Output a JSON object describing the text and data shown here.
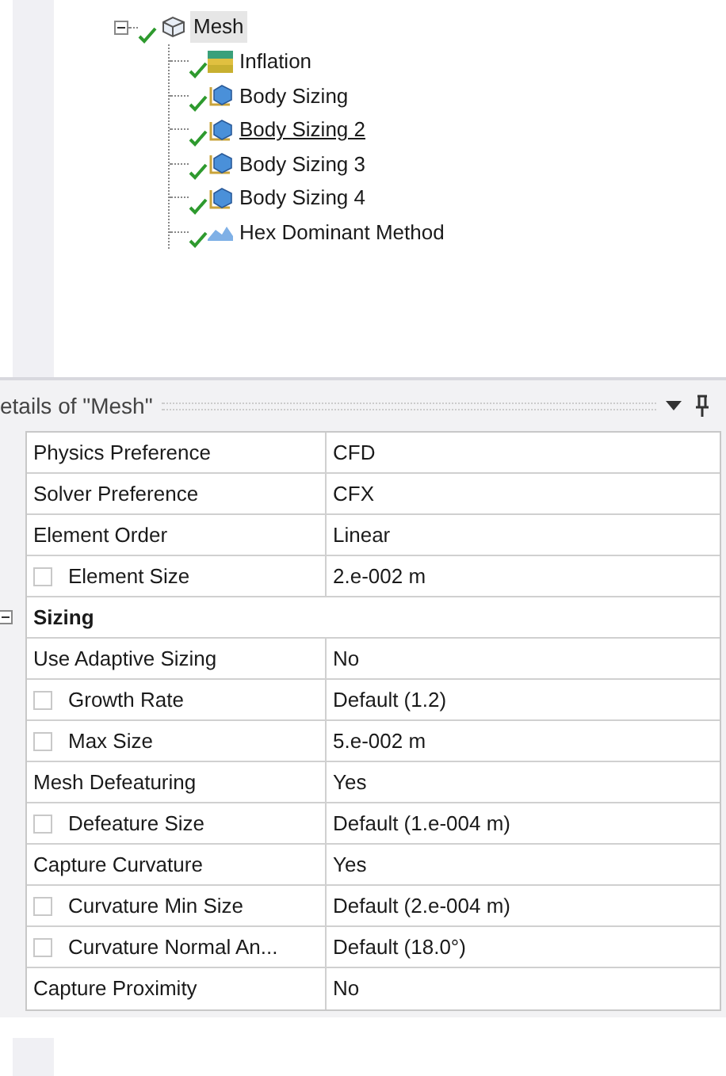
{
  "tree": {
    "label": "Mesh",
    "selected": true,
    "expanded": true,
    "children": [
      {
        "label": "Inflation",
        "kind": "inflation",
        "hovered": false
      },
      {
        "label": "Body Sizing",
        "kind": "sizing",
        "hovered": false
      },
      {
        "label": "Body Sizing 2",
        "kind": "sizing",
        "hovered": true
      },
      {
        "label": "Body Sizing 3",
        "kind": "sizing",
        "hovered": false
      },
      {
        "label": "Body Sizing 4",
        "kind": "sizing",
        "hovered": false
      },
      {
        "label": "Hex Dominant Method",
        "kind": "method",
        "hovered": false
      }
    ]
  },
  "details": {
    "title": "etails of \"Mesh\"",
    "rows": [
      {
        "kind": "prop",
        "name": "Physics Preference",
        "value": "CFD"
      },
      {
        "kind": "prop",
        "name": "Solver Preference",
        "value": "CFX"
      },
      {
        "kind": "prop",
        "name": "Element Order",
        "value": "Linear"
      },
      {
        "kind": "check",
        "name": "Element Size",
        "value": "2.e-002 m",
        "checked": false
      },
      {
        "kind": "group",
        "name": "Sizing",
        "expanded": true
      },
      {
        "kind": "prop",
        "name": "Use Adaptive Sizing",
        "value": "No"
      },
      {
        "kind": "check",
        "name": "Growth Rate",
        "value": "Default (1.2)",
        "checked": false
      },
      {
        "kind": "check",
        "name": "Max Size",
        "value": "5.e-002 m",
        "checked": false
      },
      {
        "kind": "prop",
        "name": "Mesh Defeaturing",
        "value": "Yes"
      },
      {
        "kind": "check",
        "name": "Defeature Size",
        "value": "Default (1.e-004 m)",
        "checked": false
      },
      {
        "kind": "prop",
        "name": "Capture Curvature",
        "value": "Yes"
      },
      {
        "kind": "check",
        "name": "Curvature Min Size",
        "value": "Default (2.e-004 m)",
        "checked": false
      },
      {
        "kind": "check",
        "name": "Curvature Normal An...",
        "value": "Default (18.0°)",
        "checked": false
      },
      {
        "kind": "prop",
        "name": "Capture Proximity",
        "value": "No"
      }
    ]
  }
}
